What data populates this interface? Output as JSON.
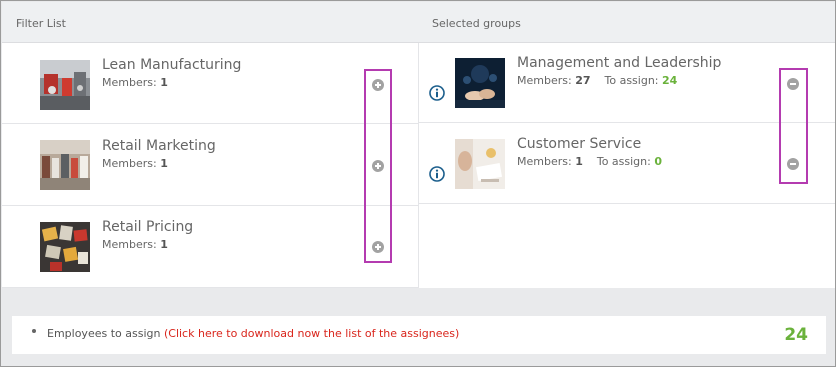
{
  "header": {
    "filter_list_label": "Filter List",
    "selected_groups_label": "Selected groups"
  },
  "filter_list": [
    {
      "name": "Lean Manufacturing",
      "members_label": "Members:",
      "members": "1",
      "thumbnail": "factory-photo"
    },
    {
      "name": "Retail Marketing",
      "members_label": "Members:",
      "members": "1",
      "thumbnail": "store-crowd-photo"
    },
    {
      "name": "Retail Pricing",
      "members_label": "Members:",
      "members": "1",
      "thumbnail": "price-tags-photo"
    }
  ],
  "selected_groups": [
    {
      "name": "Management and Leadership",
      "members_label": "Members:",
      "members": "27",
      "assign_label": "To assign:",
      "to_assign": "24",
      "thumbnail": "business-meeting-photo"
    },
    {
      "name": "Customer Service",
      "members_label": "Members:",
      "members": "1",
      "assign_label": "To assign:",
      "to_assign": "0",
      "thumbnail": "office-desk-photo"
    }
  ],
  "footer": {
    "label": "Employees to assign",
    "download_link": "(Click here to download now the list of the assignees)",
    "count": "24"
  },
  "colors": {
    "accent_green": "#6ab23b",
    "link_red": "#d9251c",
    "highlight_purple": "#b43bb0",
    "info_blue": "#1b5e8c"
  }
}
